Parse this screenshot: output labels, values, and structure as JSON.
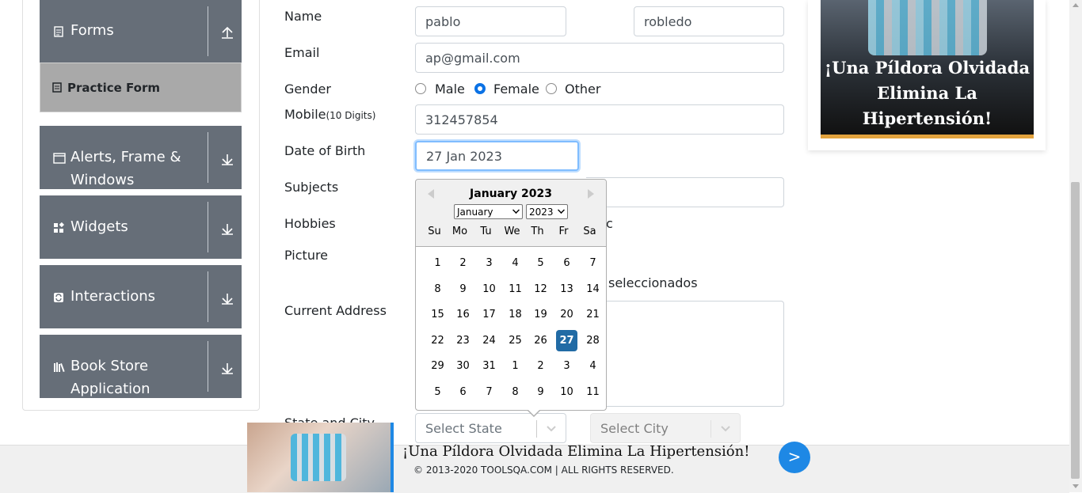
{
  "sidebar": {
    "forms": "Forms",
    "practice_form": "Practice Form",
    "alerts": "Alerts, Frame &",
    "alerts2": "Windows",
    "widgets": "Widgets",
    "interactions": "Interactions",
    "bookstore": "Book Store",
    "bookstore2": "Application"
  },
  "form": {
    "name_label": "Name",
    "first_name": "pablo",
    "last_name": "robledo",
    "email_label": "Email",
    "email": "ap@gmail.com",
    "gender_label": "Gender",
    "male": "Male",
    "female": "Female",
    "other": "Other",
    "gender_selected": "Female",
    "mobile_label": "Mobile",
    "mobile_hint": "(10 Digits)",
    "mobile": "312457854",
    "dob_label": "Date of Birth",
    "dob": "27 Jan 2023",
    "subjects_label": "Subjects",
    "hobbies_label": "Hobbies",
    "hobbies_partial": "c",
    "picture_label": "Picture",
    "picture_partial": "seleccionados",
    "address_label": "Current Address",
    "state_city_label": "State and City",
    "state_placeholder": "Select State",
    "city_placeholder": "Select City"
  },
  "datepicker": {
    "title": "January 2023",
    "month_select": "January",
    "year_select": "2023",
    "weekdays": [
      "Su",
      "Mo",
      "Tu",
      "We",
      "Th",
      "Fr",
      "Sa"
    ],
    "weeks": [
      [
        "1",
        "2",
        "3",
        "4",
        "5",
        "6",
        "7"
      ],
      [
        "8",
        "9",
        "10",
        "11",
        "12",
        "13",
        "14"
      ],
      [
        "15",
        "16",
        "17",
        "18",
        "19",
        "20",
        "21"
      ],
      [
        "22",
        "23",
        "24",
        "25",
        "26",
        "27",
        "28"
      ],
      [
        "29",
        "30",
        "31",
        "1",
        "2",
        "3",
        "4"
      ],
      [
        "5",
        "6",
        "7",
        "8",
        "9",
        "10",
        "11"
      ]
    ],
    "selected_day": "27"
  },
  "ads": {
    "right_text": "¡Una Píldora Olvidada Elimina La Hipertensión!",
    "bottom_text": "¡Una Píldora Olvidada Elimina La Hipertensión!",
    "next": ">"
  },
  "footer": {
    "copyright": "© 2013-2020 TOOLSQA.COM | ALL RIGHTS RESERVED."
  },
  "colors": {
    "accent": "#0b72e5",
    "selected_day": "#216ba5",
    "sidebar": "#666e78"
  }
}
